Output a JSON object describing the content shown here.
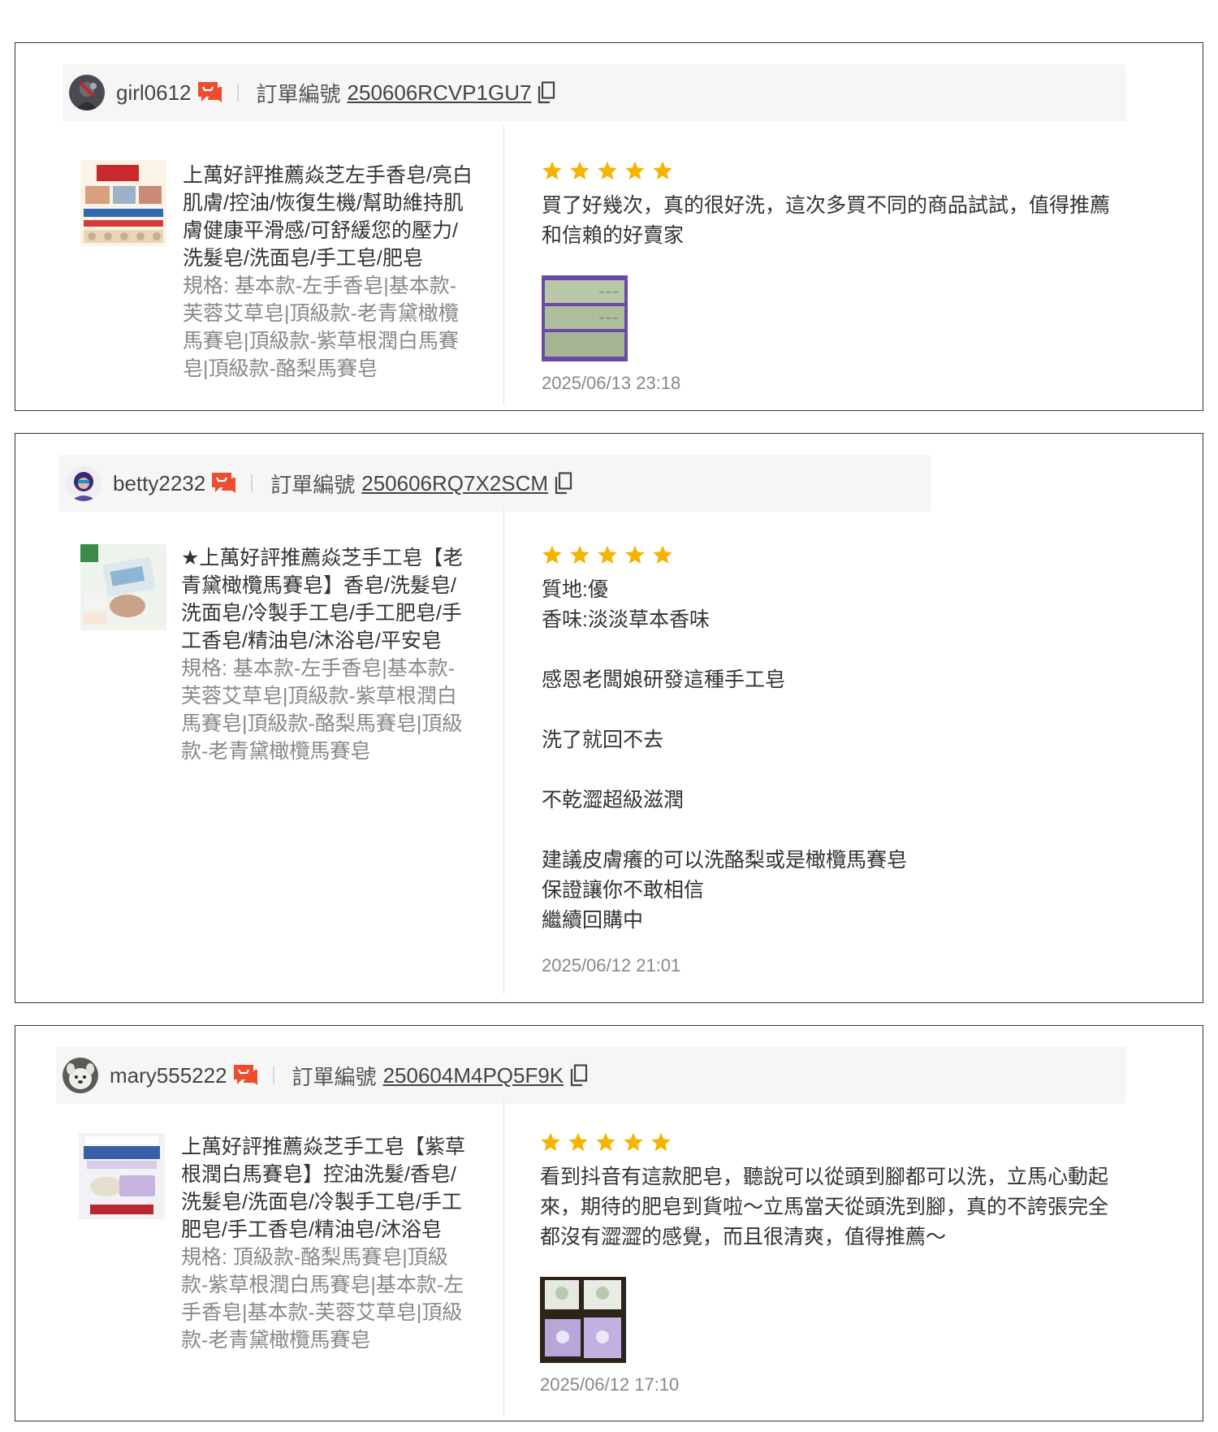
{
  "reviews": [
    {
      "username": "girl0612",
      "order_label": "訂單編號",
      "order_number": "250606RCVP1GU7",
      "product_title": "上萬好評推薦焱芝左手香皂/亮白肌膚/控油/恢復生機/幫助維持肌膚健康平滑感/可舒緩您的壓力/洗髮皂/洗面皂/手工皂/肥皂",
      "product_spec": "規格: 基本款-左手香皂|基本款-芙蓉艾草皂|頂級款-老青黛橄欖馬賽皂|頂級款-紫草根潤白馬賽皂|頂級款-酪梨馬賽皂",
      "rating": 5,
      "comment": "買了好幾次，真的很好洗，這次多買不同的商品試試，值得推薦和信賴的好賣家",
      "time": "2025/06/13 23:18"
    },
    {
      "username": "betty2232",
      "order_label": "訂單編號",
      "order_number": "250606RQ7X2SCM",
      "product_title": "★上萬好評推薦焱芝手工皂【老青黛橄欖馬賽皂】香皂/洗髮皂/洗面皂/冷製手工皂/手工肥皂/手工香皂/精油皂/沐浴皂/平安皂",
      "product_spec": "規格: 基本款-左手香皂|基本款-芙蓉艾草皂|頂級款-紫草根潤白馬賽皂|頂級款-酪梨馬賽皂|頂級款-老青黛橄欖馬賽皂",
      "rating": 5,
      "comment": "質地:優\n香味:淡淡草本香味\n\n感恩老闆娘研發這種手工皂\n\n洗了就回不去\n\n不乾澀超級滋潤\n\n建議皮膚癢的可以洗酪梨或是橄欖馬賽皂\n保證讓你不敢相信\n繼續回購中",
      "time": "2025/06/12 21:01"
    },
    {
      "username": "mary555222",
      "order_label": "訂單編號",
      "order_number": "250604M4PQ5F9K",
      "product_title": "上萬好評推薦焱芝手工皂【紫草根潤白馬賽皂】控油洗髮/香皂/洗髮皂/洗面皂/冷製手工皂/手工肥皂/手工香皂/精油皂/沐浴皂",
      "product_spec": "規格: 頂級款-酪梨馬賽皂|頂級款-紫草根潤白馬賽皂|基本款-左手香皂|基本款-芙蓉艾草皂|頂級款-老青黛橄欖馬賽皂",
      "rating": 5,
      "comment": "看到抖音有這款肥皂，聽說可以從頭到腳都可以洗，立馬心動起來，期待的肥皂到貨啦～立馬當天從頭洗到腳，真的不誇張完全都沒有澀澀的感覺，而且很清爽，值得推薦～",
      "time": "2025/06/12 17:10"
    }
  ],
  "colors": {
    "star": "#f5b400",
    "chat": "#ee4d2d"
  },
  "icons": {
    "chat": "chat-bubble-icon",
    "copy": "copy-icon",
    "star": "star-icon"
  }
}
